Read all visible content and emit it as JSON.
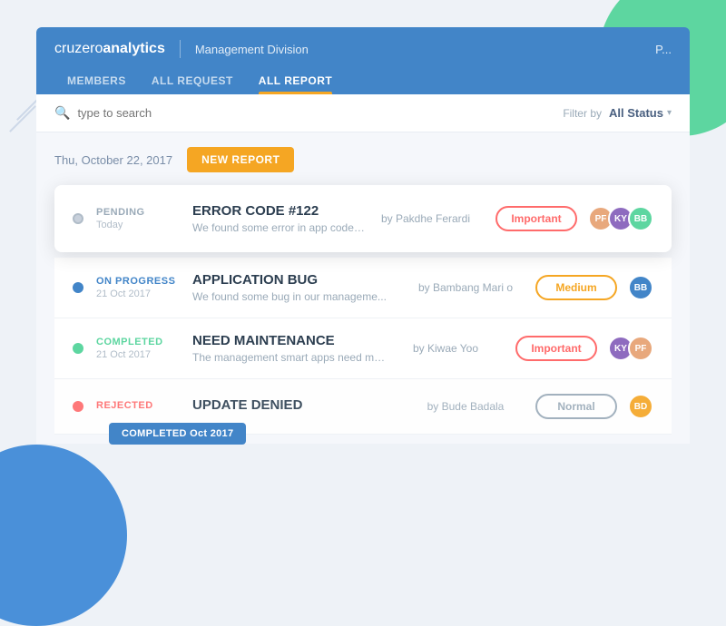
{
  "brand": {
    "name_regular": "cruzero",
    "name_bold": "analytics",
    "division": "Management Division",
    "user": "P..."
  },
  "nav": {
    "tabs": [
      {
        "id": "members",
        "label": "MEMBERS"
      },
      {
        "id": "all-request",
        "label": "ALL REQUEST"
      },
      {
        "id": "all-report",
        "label": "ALL REPORT",
        "active": true
      }
    ]
  },
  "search": {
    "placeholder": "type to search",
    "filter_label": "Filter by",
    "filter_value": "All Status"
  },
  "content": {
    "date": "Thu, October 22, 2017",
    "new_report_btn": "NEW REPORT"
  },
  "reports": [
    {
      "id": "r1",
      "status": "PENDING",
      "status_key": "pending",
      "date": "Today",
      "title": "ERROR CODE #122",
      "desc": "We found some error in app code line....",
      "author": "by Pakdhe Ferardi",
      "priority": "Important",
      "priority_key": "important",
      "card": true,
      "avatars": [
        "PF",
        "KY",
        "BB"
      ]
    },
    {
      "id": "r2",
      "status": "ON PROGRESS",
      "status_key": "on-progress",
      "date": "21 Oct 2017",
      "title": "APPLICATION BUG",
      "desc": "We found some bug in our manageme...",
      "author": "by Bambang Mari o",
      "priority": "Medium",
      "priority_key": "medium",
      "card": false,
      "avatars": [
        "BB"
      ]
    },
    {
      "id": "r3",
      "status": "COMPLETED",
      "status_key": "completed",
      "date": "21 Oct 2017",
      "title": "NEED MAINTENANCE",
      "desc": "The management smart apps need mai...",
      "author": "by Kiwae Yoo",
      "priority": "Important",
      "priority_key": "important",
      "card": false,
      "avatars": [
        "KY",
        "PF"
      ]
    },
    {
      "id": "r4",
      "status": "REJECTED",
      "status_key": "rejected",
      "date": "",
      "title": "UPDATE DENIED",
      "desc": "",
      "author": "by Bude Badala",
      "priority": "Normal",
      "priority_key": "normal",
      "card": false,
      "avatars": [
        "BD"
      ]
    }
  ],
  "completed_label": "COMPLETED Oct 2017"
}
